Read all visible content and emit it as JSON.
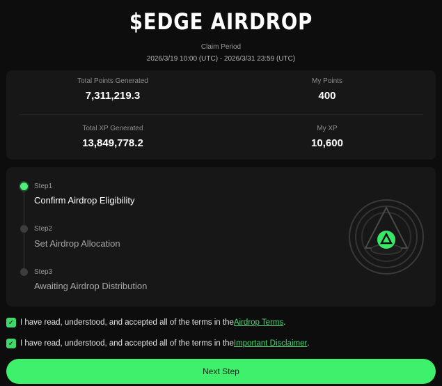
{
  "header": {
    "title": "$EDGE AIRDROP",
    "claim_label": "Claim Period",
    "claim_dates": "2026/3/19 10:00 (UTC) - 2026/3/31 23:59 (UTC)"
  },
  "stats": {
    "total_points_label": "Total Points Generated",
    "total_points_value": "7,311,219.3",
    "my_points_label": "My Points",
    "my_points_value": "400",
    "total_xp_label": "Total XP Generated",
    "total_xp_value": "13,849,778.2",
    "my_xp_label": "My XP",
    "my_xp_value": "10,600"
  },
  "steps": [
    {
      "number": "Step1",
      "label": "Confirm Airdrop Eligibility",
      "active": true
    },
    {
      "number": "Step2",
      "label": "Set Airdrop Allocation",
      "active": false
    },
    {
      "number": "Step3",
      "label": "Awaiting Airdrop Distribution",
      "active": false
    }
  ],
  "agreements": [
    {
      "text": "I have read, understood, and accepted all of the terms in the ",
      "link": "Airdrop Terms",
      "suffix": ".",
      "checked": true
    },
    {
      "text": "I have read, understood, and accepted all of the terms in the ",
      "link": "Important Disclaimer",
      "suffix": ".",
      "checked": true
    }
  ],
  "next_button": "Next Step",
  "colors": {
    "accent": "#3ff06c",
    "background": "#0d0d0d",
    "card": "#171717"
  }
}
